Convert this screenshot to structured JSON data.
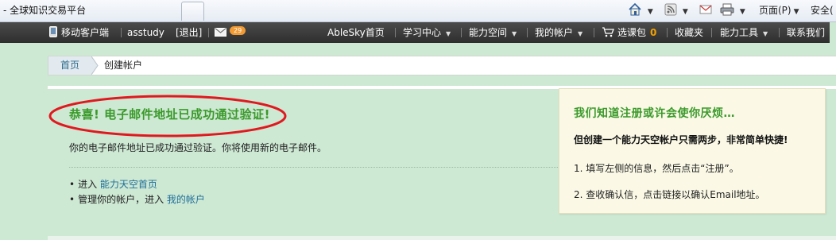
{
  "browser": {
    "tab_title": "- 全球知识交易平台",
    "toolbar": {
      "page_menu": "页面(P)",
      "safety_menu": "安全("
    },
    "icons": [
      "home-icon",
      "rss-icon",
      "mail-icon",
      "print-icon"
    ]
  },
  "site_nav": {
    "mobile_client": "移动客户端",
    "username": "asstudy",
    "logout": "[退出]",
    "mail_count": "29",
    "items": [
      {
        "label": "AbleSky首页",
        "has_menu": false
      },
      {
        "label": "学习中心",
        "has_menu": true
      },
      {
        "label": "能力空间",
        "has_menu": true
      },
      {
        "label": "我的帐户",
        "has_menu": true
      },
      {
        "label": "选课包",
        "has_menu": false
      },
      {
        "label": "收藏夹",
        "has_menu": false
      },
      {
        "label": "能力工具",
        "has_menu": true
      },
      {
        "label": "联系我们",
        "has_menu": true
      }
    ],
    "cart_count": "0"
  },
  "breadcrumb": {
    "home": "首页",
    "current": "创建帐户"
  },
  "main": {
    "success_title": "恭喜! 电子邮件地址已成功通过验证!",
    "success_desc": "你的电子邮件地址已成功通过验证。你将使用新的电子邮件。",
    "links": [
      {
        "prefix": "进入 ",
        "link": "能力天空首页"
      },
      {
        "prefix": "管理你的帐户，进入 ",
        "link": "我的帐户"
      }
    ]
  },
  "tip_panel": {
    "title": "我们知道注册或许会使你厌烦…",
    "subtitle": "但创建一个能力天空帐户只需两步，非常简单快捷!",
    "step1": "1. 填写左侧的信息，然后点击“注册”。",
    "step2": "2. 查收确认信，点击链接以确认Email地址。"
  },
  "colors": {
    "page_bg": "#cde8d3",
    "nav_bg": "#3a3a3a",
    "accent_green": "#3a9a2a",
    "link_blue": "#1f6f9a",
    "highlight_red": "#e0191f",
    "badge_orange": "#f29a34"
  }
}
